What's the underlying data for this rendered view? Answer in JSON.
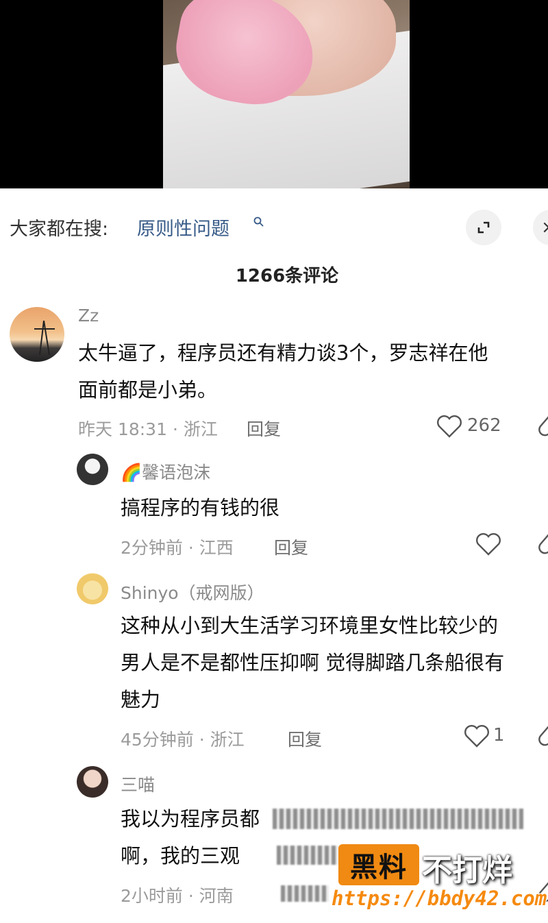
{
  "search": {
    "prefix": "大家都在搜:",
    "term": "原则性问题",
    "expand_icon": "expand-icon",
    "close_icon": "close-icon",
    "close_glyph": "×"
  },
  "comments_header": {
    "count_label": "1266条评论"
  },
  "comments": [
    {
      "user": "Zz",
      "text_lines": [
        "太牛逼了，程序员还有精力谈3个，罗志祥在他",
        "面前都是小弟。"
      ],
      "time_location": "昨天 18:31 · 浙江",
      "reply": "回复",
      "likes": "262"
    },
    {
      "user": "🌈馨语泡沫",
      "text_lines": [
        "搞程序的有钱的很"
      ],
      "time_location": "2分钟前 · 江西",
      "reply": "回复",
      "likes": ""
    },
    {
      "user": "Shinyo（戒网版）",
      "text_lines": [
        "这种从小到大生活学习环境里女性比较少的",
        "男人是不是都性压抑啊 觉得脚踏几条船很有",
        "魅力"
      ],
      "time_location": "45分钟前 · 浙江",
      "reply": "回复",
      "likes": "1"
    },
    {
      "user": "三喵",
      "text_lines": [
        "我以为程序员都",
        "啊，我的三观"
      ],
      "time_location": "2小时前 · 河南",
      "reply": "",
      "likes": ""
    }
  ],
  "watermark": {
    "badge": "黑料",
    "text": "不打烊",
    "url": "https://bbdy42.com"
  },
  "colors": {
    "link_blue": "#365a87",
    "watermark_orange": "#f08a12"
  }
}
